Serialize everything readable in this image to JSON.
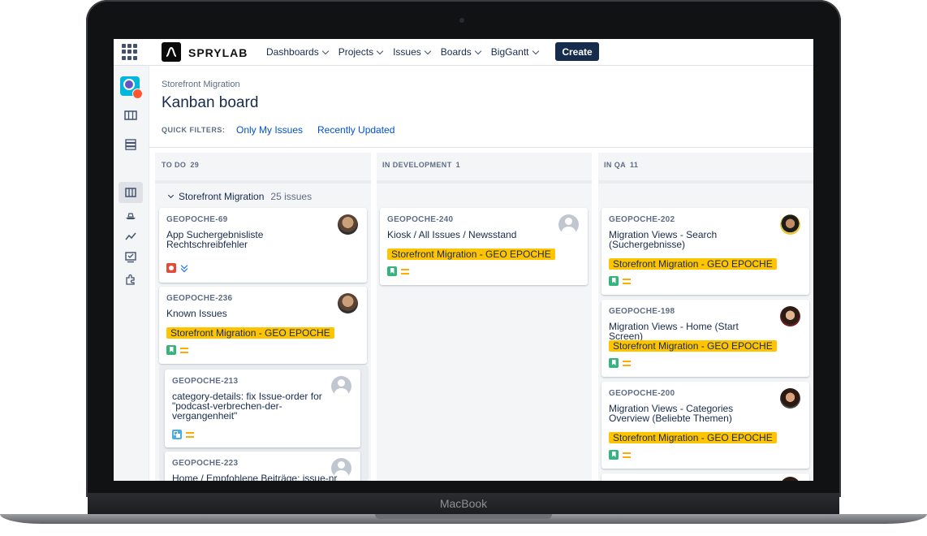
{
  "device": {
    "brand": "MacBook"
  },
  "nav": {
    "logo_text": "SPRYLAB",
    "menus": [
      "Dashboards",
      "Projects",
      "Issues",
      "Boards",
      "BigGantt"
    ],
    "create_label": "Create"
  },
  "rail_icons": [
    "project-avatar-icon",
    "board-icon",
    "backlog-icon",
    "active-board-icon",
    "releases-icon",
    "reports-icon",
    "issues-icon",
    "add-ons-icon"
  ],
  "page": {
    "breadcrumb": "Storefront Migration",
    "title": "Kanban board",
    "quick_filters_label": "QUICK FILTERS:",
    "quick_filters": [
      "Only My Issues",
      "Recently Updated"
    ]
  },
  "columns": [
    {
      "name": "TO DO",
      "count": "29"
    },
    {
      "name": "IN DEVELOPMENT",
      "count": "1"
    },
    {
      "name": "IN QA",
      "count": "11"
    }
  ],
  "swimlane": {
    "name": "Storefront Migration",
    "count_text": "25 issues"
  },
  "epic_label": "Storefront Migration - GEO EPOCHE",
  "cards": {
    "todo": [
      {
        "key": "GEOPOCHE-69",
        "summary": "App Suchergebnisliste Rechtschreibfehler",
        "type": "bug",
        "priority": "low"
      },
      {
        "key": "GEOPOCHE-236",
        "summary": "Known Issues",
        "type": "story",
        "priority": "medium"
      },
      {
        "key": "GEOPOCHE-213",
        "summary": "category-details: fix Issue-order for \"podcast-verbrechen-der-vergangenheit\"",
        "type": "subtask",
        "priority": "medium"
      },
      {
        "key": "GEOPOCHE-223",
        "summary": "Home / Empfohlene Beiträge: issue-nr"
      }
    ],
    "dev": [
      {
        "key": "GEOPOCHE-240",
        "summary": "Kiosk / All Issues / Newsstand",
        "type": "story",
        "priority": "medium"
      }
    ],
    "qa": [
      {
        "key": "GEOPOCHE-202",
        "summary": "Migration Views - Search (Suchergebnisse)",
        "type": "story",
        "priority": "medium"
      },
      {
        "key": "GEOPOCHE-198",
        "summary": "Migration Views - Home (Start Screen)",
        "type": "story",
        "priority": "medium"
      },
      {
        "key": "GEOPOCHE-200",
        "summary": "Migration Views - Categories Overview (Beliebte Themen)",
        "type": "story",
        "priority": "medium"
      }
    ]
  },
  "colors": {
    "accent": "#0052cc",
    "nav_dark": "#172b4d",
    "epic": "#ffc400",
    "column_bg": "#f4f5f7"
  }
}
